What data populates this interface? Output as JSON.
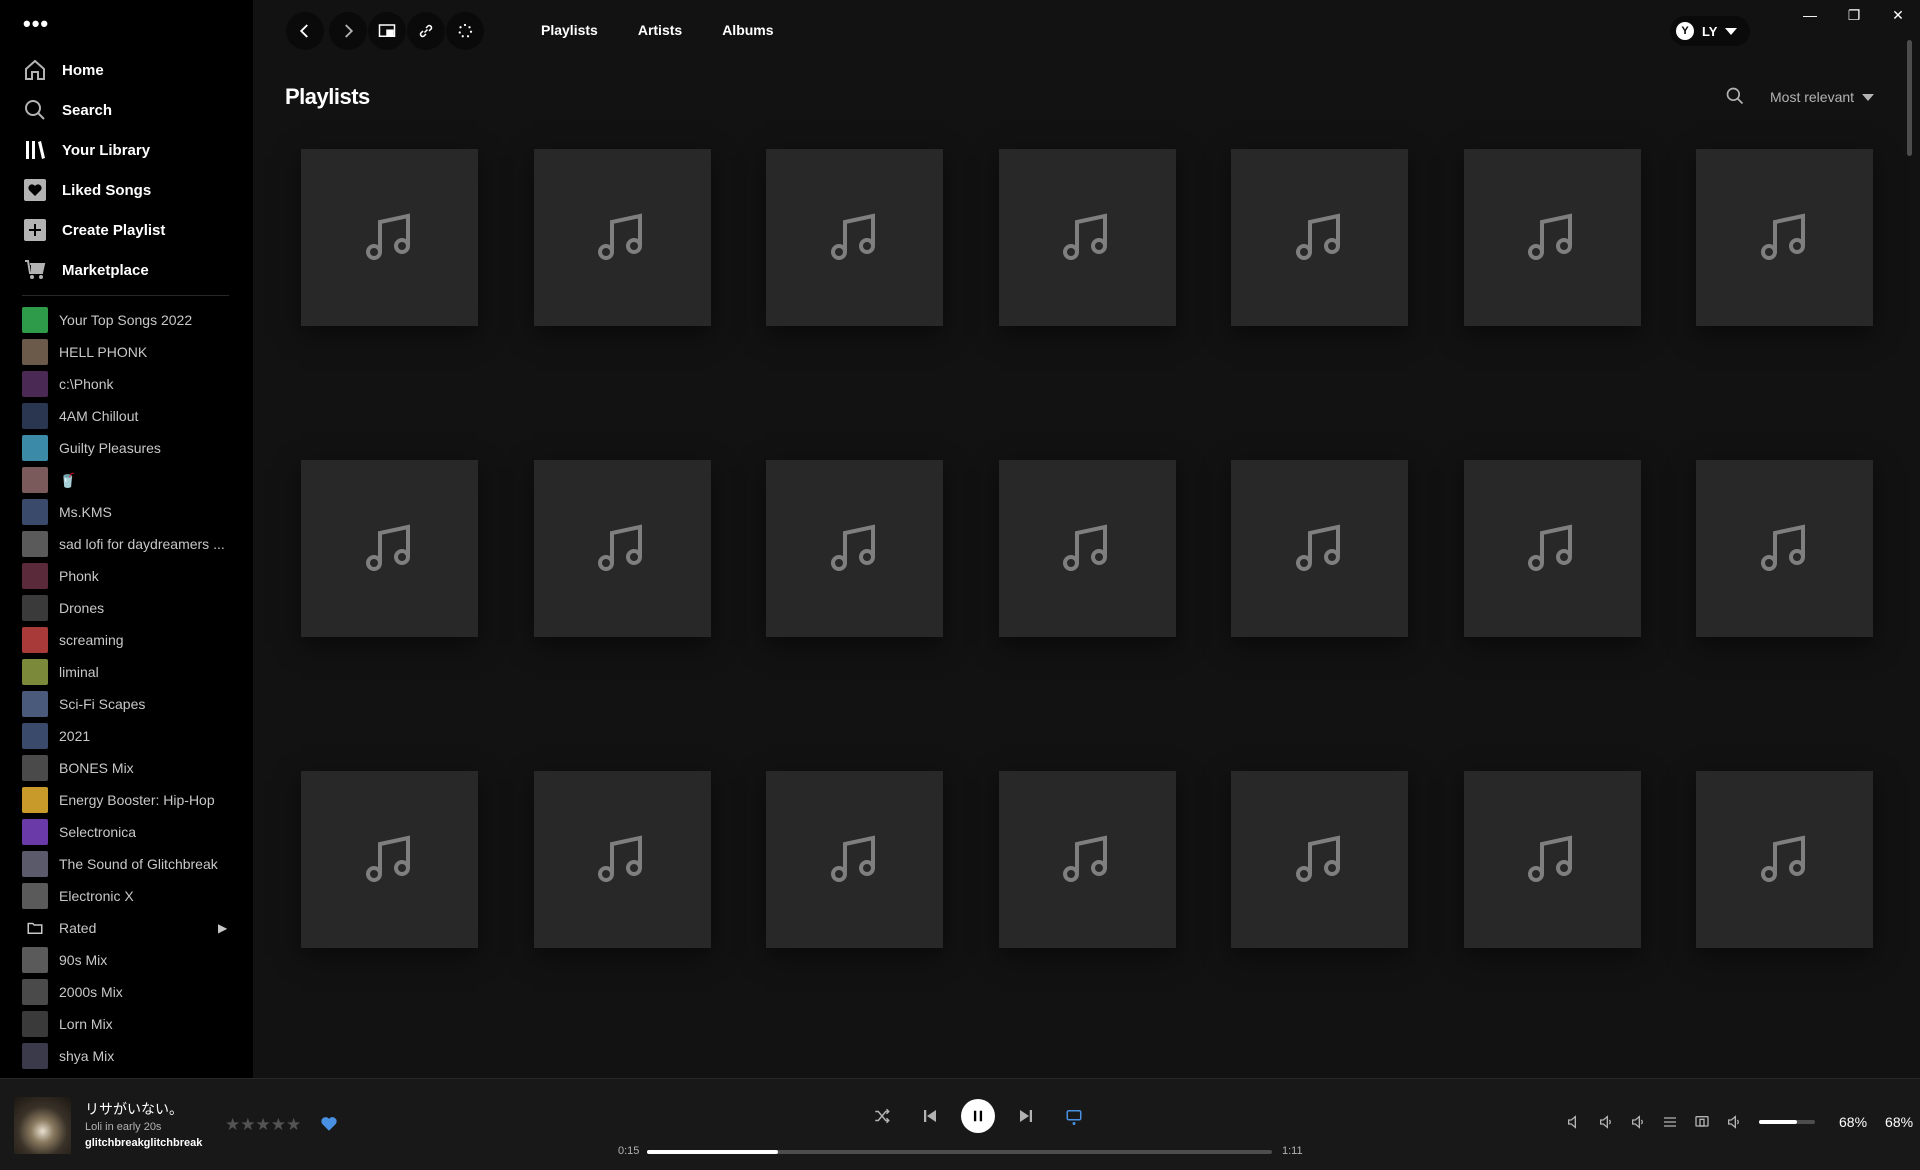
{
  "window": {
    "menu_label": "•••",
    "controls": [
      "—",
      "❐",
      "✕"
    ]
  },
  "nav": {
    "items": [
      {
        "label": "Home",
        "icon": "home-icon"
      },
      {
        "label": "Search",
        "icon": "search-icon"
      },
      {
        "label": "Your Library",
        "icon": "library-icon",
        "active": true
      },
      {
        "label": "Liked Songs",
        "icon": "heart-icon"
      },
      {
        "label": "Create Playlist",
        "icon": "plus-icon"
      },
      {
        "label": "Marketplace",
        "icon": "cart-icon"
      }
    ]
  },
  "sidebar_playlists": [
    {
      "label": "Your Top Songs 2022",
      "color": "#2e9b4a"
    },
    {
      "label": "HELL PHONK",
      "color": "#6b5a4a"
    },
    {
      "label": "c:\\Phonk",
      "color": "#4a2a55"
    },
    {
      "label": "4AM Chillout",
      "color": "#2a3550"
    },
    {
      "label": "Guilty Pleasures",
      "color": "#3a8aa8"
    },
    {
      "label": "🥤",
      "color": "#7a5a5a"
    },
    {
      "label": "Ms.KMS",
      "color": "#3a4a6a"
    },
    {
      "label": "sad lofi for daydreamers ...",
      "color": "#5a5a5a"
    },
    {
      "label": "Phonk",
      "color": "#5a2a3a"
    },
    {
      "label": "Drones",
      "color": "#3a3a3a"
    },
    {
      "label": "screaming",
      "color": "#a83a3a"
    },
    {
      "label": "liminal",
      "color": "#7a8a3a"
    },
    {
      "label": "Sci-Fi Scapes",
      "color": "#4a5a7a"
    },
    {
      "label": "2021",
      "color": "#3a4a6a"
    },
    {
      "label": "BONES Mix",
      "color": "#4a4a4a"
    },
    {
      "label": "Energy Booster: Hip-Hop",
      "color": "#c89a2a"
    },
    {
      "label": "Selectronica",
      "color": "#6a3aa8"
    },
    {
      "label": "The Sound of Glitchbreak",
      "color": "#5a5a6a"
    },
    {
      "label": "Electronic X",
      "color": "#5a5a5a"
    },
    {
      "label": "Rated",
      "folder": true
    },
    {
      "label": "90s Mix",
      "color": "#5a5a5a"
    },
    {
      "label": "2000s Mix",
      "color": "#4a4a4a"
    },
    {
      "label": "Lorn Mix",
      "color": "#3a3a3a"
    },
    {
      "label": "shya Mix",
      "color": "#3a3a4a"
    }
  ],
  "topbar": {
    "tabs": [
      "Playlists",
      "Artists",
      "Albums"
    ],
    "user_initials": "LY",
    "avatar_letter": "Y"
  },
  "page": {
    "title": "Playlists",
    "sort_label": "Most relevant"
  },
  "grid": {
    "count": 21,
    "placeholder_icon": "music-note-icon"
  },
  "player": {
    "track_title": "リサがいない。",
    "track_subtitle": "Loli in early 20s",
    "track_artist": "glitchbreakglitchbreak",
    "rating_stars": "★★★★★",
    "elapsed": "0:15",
    "duration": "1:11",
    "progress": 0.21,
    "volume": 0.68,
    "volume_label_1": "68%",
    "volume_label_2": "68%",
    "accent_color": "#4a90e2"
  }
}
